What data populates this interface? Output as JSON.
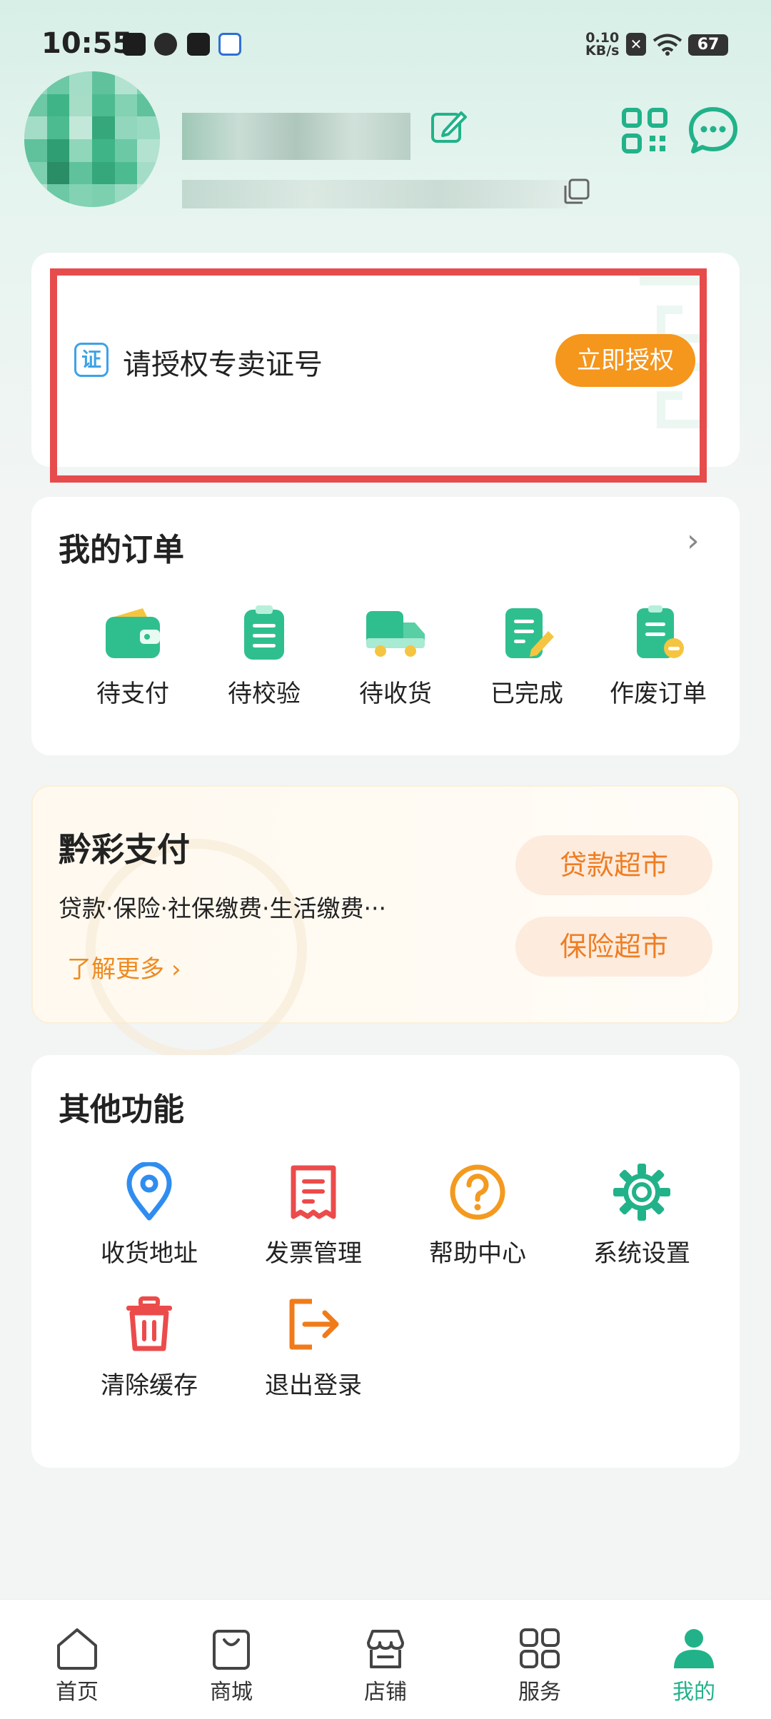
{
  "status_bar": {
    "time": "10:55",
    "net_speed": "0.10",
    "net_unit": "KB/s",
    "battery": "67"
  },
  "license": {
    "icon_char": "证",
    "text": "请授权专卖证号",
    "button": "立即授权"
  },
  "orders": {
    "title": "我的订单",
    "items": [
      {
        "label": "待支付",
        "icon": "wallet-icon"
      },
      {
        "label": "待校验",
        "icon": "clipboard-icon"
      },
      {
        "label": "待收货",
        "icon": "truck-icon"
      },
      {
        "label": "已完成",
        "icon": "doc-edit-icon"
      },
      {
        "label": "作废订单",
        "icon": "doc-void-icon"
      }
    ]
  },
  "payment": {
    "title": "黔彩支付",
    "desc": "贷款·保险·社保缴费·生活缴费···",
    "more": "了解更多",
    "buttons": [
      "贷款超市",
      "保险超市"
    ]
  },
  "other": {
    "title": "其他功能",
    "items": [
      {
        "label": "收货地址",
        "icon": "location-icon"
      },
      {
        "label": "发票管理",
        "icon": "invoice-icon"
      },
      {
        "label": "帮助中心",
        "icon": "help-icon"
      },
      {
        "label": "系统设置",
        "icon": "gear-icon"
      },
      {
        "label": "清除缓存",
        "icon": "trash-icon"
      },
      {
        "label": "退出登录",
        "icon": "logout-icon"
      }
    ]
  },
  "nav": {
    "items": [
      {
        "label": "首页",
        "icon": "home-icon"
      },
      {
        "label": "商城",
        "icon": "bag-icon"
      },
      {
        "label": "店铺",
        "icon": "store-icon"
      },
      {
        "label": "服务",
        "icon": "grid-icon"
      },
      {
        "label": "我的",
        "icon": "user-icon"
      }
    ],
    "active_index": 4,
    "active_color": "#22b28a"
  },
  "colors": {
    "brand_green": "#22b28a",
    "orange": "#f5961d",
    "highlight_red": "#e74c4c"
  }
}
